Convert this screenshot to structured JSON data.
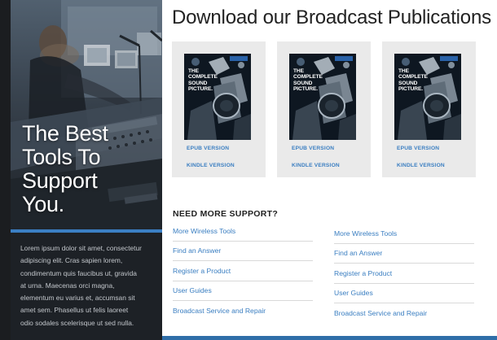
{
  "hero": {
    "title_lines": [
      "The Best",
      "Tools To",
      "Support",
      "You."
    ],
    "paragraph_lines": [
      "Lorem ipsum dolor sit amet, consectetur",
      "adipiscing elit. Cras sapien lorem,",
      "condimentum quis faucibus ut, gravida",
      "at urna. Maecenas orci magna,",
      "elementum eu varius et, accumsan sit",
      "amet sem. Phasellus ut felis laoreet",
      "odio sodales scelerisque ut sed nulla."
    ]
  },
  "main": {
    "title": "Download our Broadcast Publications",
    "publications": [
      {
        "cover_lines": [
          "THE",
          "COMPLETE",
          "SOUND",
          "PICTURE."
        ],
        "epub_label": "EPUB VERSION",
        "kindle_label": "KINDLE VERSION"
      },
      {
        "cover_lines": [
          "THE",
          "COMPLETE",
          "SOUND",
          "PICTURE."
        ],
        "epub_label": "EPUB VERSION",
        "kindle_label": "KINDLE VERSION"
      },
      {
        "cover_lines": [
          "THE",
          "COMPLETE",
          "SOUND",
          "PICTURE."
        ],
        "epub_label": "EPUB VERSION",
        "kindle_label": "KINDLE VERSION"
      }
    ],
    "support": {
      "heading": "NEED MORE SUPPORT?",
      "left_links": [
        "More Wireless Tools",
        "Find an Answer",
        "Register a Product",
        "User Guides",
        "Broadcast Service and Repair"
      ],
      "right_links": [
        "More Wireless Tools",
        "Find an Answer",
        "Register a Product",
        "User Guides",
        "Broadcast Service and Repair"
      ]
    }
  },
  "colors": {
    "accent_blue": "#3a7ec1",
    "hero_bar": "#3b7fc4",
    "dark_panel": "#1d2126",
    "card_bg": "#eaeaea",
    "bottom_bar": "#2f6ea8"
  },
  "icons": {
    "hero_image": "broadcast-studio-photo",
    "cover_image": "broadcast-camera-photo"
  }
}
